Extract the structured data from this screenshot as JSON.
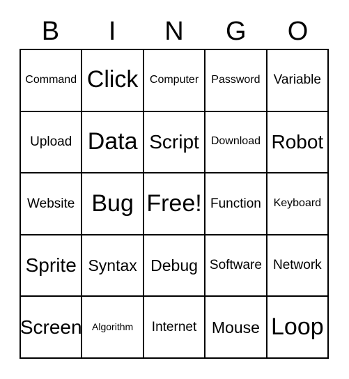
{
  "card": {
    "title": "BINGO",
    "header_letters": [
      "B",
      "I",
      "N",
      "G",
      "O"
    ],
    "columns": 5,
    "rows": 5,
    "free_space": "Free!",
    "colors": {
      "background": "#ffffff",
      "grid_line": "#000000",
      "text": "#000000"
    },
    "cells": [
      [
        {
          "label": "Command",
          "size": "s"
        },
        {
          "label": "Click",
          "size": "xxl"
        },
        {
          "label": "Computer",
          "size": "s"
        },
        {
          "label": "Password",
          "size": "s"
        },
        {
          "label": "Variable",
          "size": "m"
        }
      ],
      [
        {
          "label": "Upload",
          "size": "m"
        },
        {
          "label": "Data",
          "size": "xxl"
        },
        {
          "label": "Script",
          "size": "xl"
        },
        {
          "label": "Download",
          "size": "s"
        },
        {
          "label": "Robot",
          "size": "xl"
        }
      ],
      [
        {
          "label": "Website",
          "size": "m"
        },
        {
          "label": "Bug",
          "size": "xxl"
        },
        {
          "label": "Free!",
          "size": "xxl"
        },
        {
          "label": "Function",
          "size": "m"
        },
        {
          "label": "Keyboard",
          "size": "s"
        }
      ],
      [
        {
          "label": "Sprite",
          "size": "xl"
        },
        {
          "label": "Syntax",
          "size": "l"
        },
        {
          "label": "Debug",
          "size": "l"
        },
        {
          "label": "Software",
          "size": "m"
        },
        {
          "label": "Network",
          "size": "m"
        }
      ],
      [
        {
          "label": "Screen",
          "size": "xl"
        },
        {
          "label": "Algorithm",
          "size": "xs"
        },
        {
          "label": "Internet",
          "size": "m"
        },
        {
          "label": "Mouse",
          "size": "l"
        },
        {
          "label": "Loop",
          "size": "xxl"
        }
      ]
    ]
  }
}
